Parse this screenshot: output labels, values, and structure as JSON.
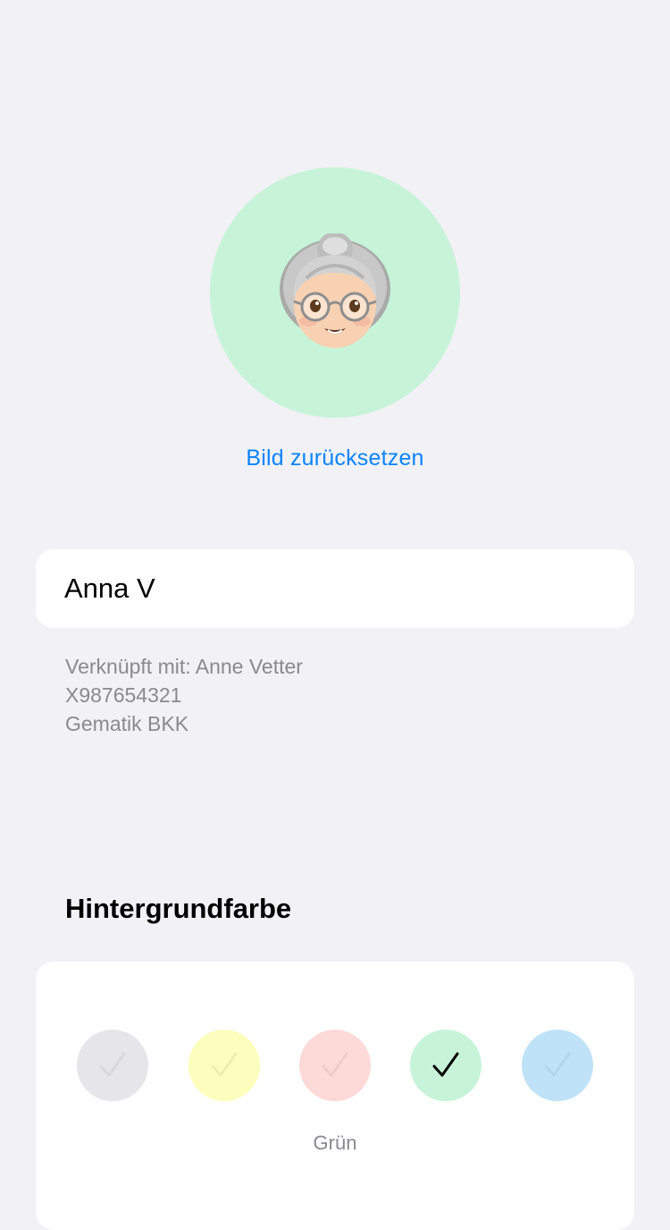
{
  "profile": {
    "avatar_icon": "old-woman-emoji-icon",
    "avatar_background": "#c7f4d8",
    "reset_label": "Bild zurücksetzen",
    "name_value": "Anna V",
    "linked_to": "Verknüpft mit: Anne Vetter",
    "insurance_number": "X987654321",
    "insurance_name": "Gematik BKK"
  },
  "background_color": {
    "title": "Hintergrundfarbe",
    "selected_label": "Grün",
    "options": [
      {
        "name": "grey-swatch",
        "color": "#e5e5ea",
        "selected": false
      },
      {
        "name": "yellow-swatch",
        "color": "#fdfdbd",
        "selected": false
      },
      {
        "name": "red-swatch",
        "color": "#fdd9d7",
        "selected": false
      },
      {
        "name": "green-swatch",
        "color": "#c7f4d8",
        "selected": true
      },
      {
        "name": "blue-swatch",
        "color": "#bfe2f8",
        "selected": false
      }
    ]
  }
}
